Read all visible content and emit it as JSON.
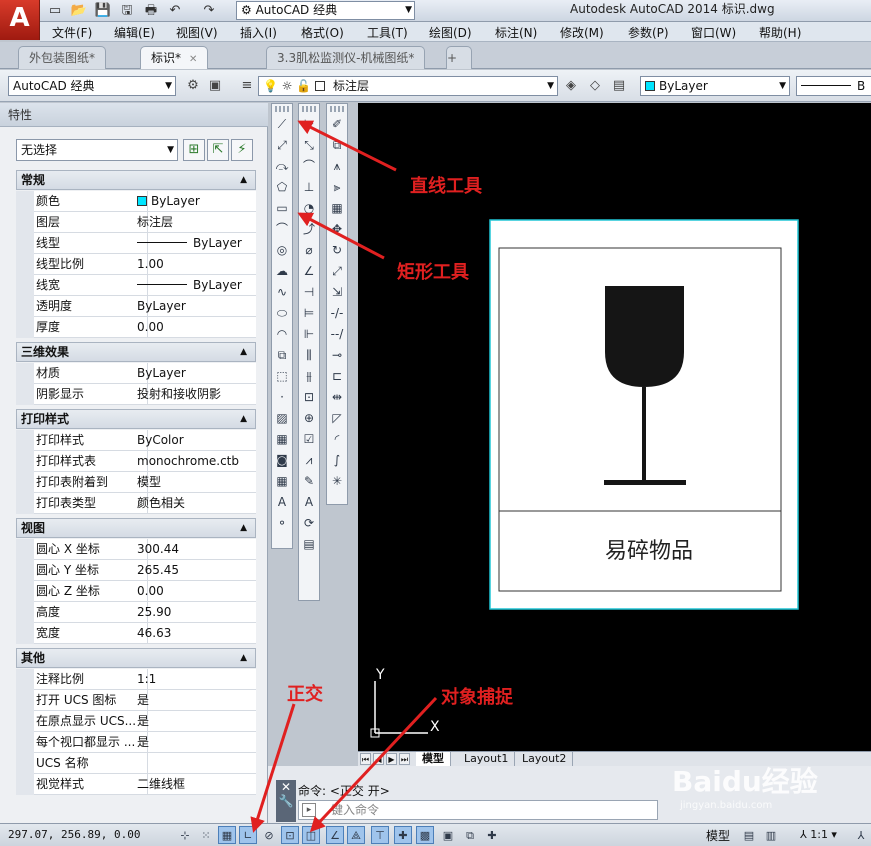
{
  "app": {
    "logo_letter": "A",
    "title": "Autodesk AutoCAD 2014    标识.dwg",
    "workspace": "AutoCAD 经典"
  },
  "menu": [
    "文件(F)",
    "编辑(E)",
    "视图(V)",
    "插入(I)",
    "格式(O)",
    "工具(T)",
    "绘图(D)",
    "标注(N)",
    "修改(M)",
    "参数(P)",
    "窗口(W)",
    "帮助(H)"
  ],
  "doc_tabs": [
    {
      "label": "外包装图纸*",
      "active": false
    },
    {
      "label": "标识*",
      "active": true
    },
    {
      "label": "3.3肌松监测仪-机械图纸*",
      "active": false
    }
  ],
  "toolbar": {
    "workspace": "AutoCAD 经典",
    "layer": "标注层",
    "color": "ByLayer",
    "linetype_prefix": "B"
  },
  "properties": {
    "header": "特性",
    "selection": "无选择",
    "sections": [
      {
        "title": "常规",
        "rows": [
          {
            "name": "颜色",
            "value": "ByLayer",
            "kind": "color"
          },
          {
            "name": "图层",
            "value": "标注层"
          },
          {
            "name": "线型",
            "value": "ByLayer",
            "kind": "line"
          },
          {
            "name": "线型比例",
            "value": "1.00"
          },
          {
            "name": "线宽",
            "value": "ByLayer",
            "kind": "line"
          },
          {
            "name": "透明度",
            "value": "ByLayer"
          },
          {
            "name": "厚度",
            "value": "0.00"
          }
        ]
      },
      {
        "title": "三维效果",
        "rows": [
          {
            "name": "材质",
            "value": "ByLayer"
          },
          {
            "name": "阴影显示",
            "value": "投射和接收阴影"
          }
        ]
      },
      {
        "title": "打印样式",
        "rows": [
          {
            "name": "打印样式",
            "value": "ByColor"
          },
          {
            "name": "打印样式表",
            "value": "monochrome.ctb"
          },
          {
            "name": "打印表附着到",
            "value": "模型"
          },
          {
            "name": "打印表类型",
            "value": "颜色相关"
          }
        ]
      },
      {
        "title": "视图",
        "rows": [
          {
            "name": "圆心 X 坐标",
            "value": "300.44"
          },
          {
            "name": "圆心 Y 坐标",
            "value": "265.45"
          },
          {
            "name": "圆心 Z 坐标",
            "value": "0.00"
          },
          {
            "name": "高度",
            "value": "25.90"
          },
          {
            "name": "宽度",
            "value": "46.63"
          }
        ]
      },
      {
        "title": "其他",
        "rows": [
          {
            "name": "注释比例",
            "value": "1:1"
          },
          {
            "name": "打开 UCS 图标",
            "value": "是"
          },
          {
            "name": "在原点显示 UCS...",
            "value": "是"
          },
          {
            "name": "每个视口都显示 ...",
            "value": "是"
          },
          {
            "name": "UCS 名称",
            "value": ""
          },
          {
            "name": "视觉样式",
            "value": "二维线框"
          }
        ]
      }
    ]
  },
  "drawing": {
    "label_text": "易碎物品",
    "ucs_x": "X",
    "ucs_y": "Y"
  },
  "layout_tabs": [
    "模型",
    "Layout1",
    "Layout2"
  ],
  "command": {
    "history": "命令: <正交 开>",
    "placeholder": "键入命令"
  },
  "status": {
    "coords": "297.07, 256.89, 0.00",
    "model": "模型",
    "scale": "1:1"
  },
  "annotations": {
    "line_tool": "直线工具",
    "rect_tool": "矩形工具",
    "ortho": "正交",
    "osnap": "对象捕捉"
  },
  "watermark": {
    "main": "Baidu经验",
    "sub": "jingyan.baidu.com"
  },
  "colors": {
    "annotation": "#e02020",
    "canvas": "#000000",
    "bylayer_swatch": "#00e5ff"
  }
}
